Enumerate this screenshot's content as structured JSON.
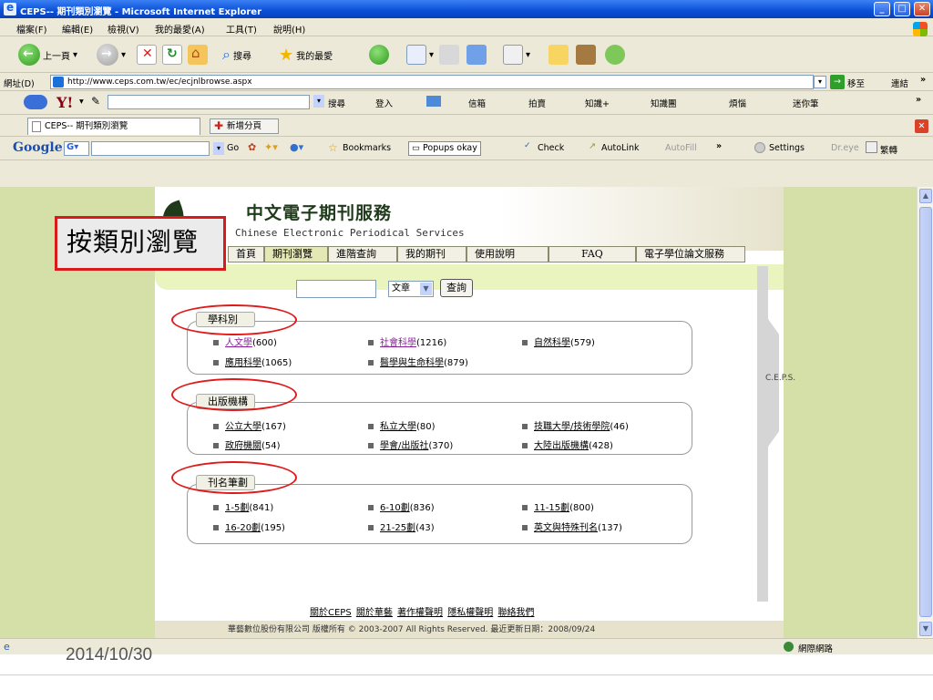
{
  "window": {
    "title": "CEPS-- 期刊類別瀏覽 - Microsoft Internet Explorer",
    "minimize": "_",
    "maximize": "□",
    "close": "✕"
  },
  "menubar": {
    "items": [
      "檔案(F)",
      "編輯(E)",
      "檢視(V)",
      "我的最愛(A)",
      "工具(T)",
      "說明(H)"
    ]
  },
  "toolbar": {
    "back_label": "上一頁",
    "search_label": "搜尋",
    "favorites_label": "我的最愛"
  },
  "address": {
    "label": "網址(D)",
    "url": "http://www.ceps.com.tw/ec/ecjnlbrowse.aspx",
    "go_label": "移至",
    "links_label": "連結"
  },
  "yahoo_toolbar": {
    "search_label": "搜尋",
    "login_label": "登入",
    "mail_label": "信箱",
    "auction_label": "拍賣",
    "knowledge_label": "知識+",
    "knowledge_group_label": "知識團",
    "worry_label": "煩惱",
    "pen_label": "迷你筆"
  },
  "tabs": {
    "current_tab": "CEPS-- 期刊類別瀏覽",
    "new_tab_label": "新增分頁"
  },
  "google_toolbar": {
    "logo": "Google",
    "g_label": "G",
    "go_label": "Go",
    "bookmarks_label": "Bookmarks",
    "popups_label": "Popups okay",
    "check_label": "Check",
    "autolink_label": "AutoLink",
    "autofill_label": "AutoFill",
    "more": "»",
    "settings_label": "Settings",
    "dreye_label": "Dr.eye",
    "convert_label": "繁轉"
  },
  "callout": {
    "text": "按類別瀏覽"
  },
  "site": {
    "title": "中文電子期刊服務",
    "subtitle": "Chinese Electronic Periodical Services",
    "side_label": "C.E.P.S.",
    "nav": [
      "首頁",
      "期刊瀏覽",
      "進階查詢",
      "我的期刊",
      "使用說明",
      "FAQ",
      "電子學位論文服務"
    ],
    "search_select": "文章",
    "search_button": "查詢"
  },
  "sections": [
    {
      "label": "學科別",
      "items": [
        {
          "name": "人文學",
          "count": "(600)"
        },
        {
          "name": "社會科學",
          "count": "(1216)"
        },
        {
          "name": "自然科學",
          "count": "(579)"
        },
        {
          "name": "應用科學",
          "count": "(1065)"
        },
        {
          "name": "醫學與生命科學",
          "count": "(879)"
        }
      ]
    },
    {
      "label": "出版機構",
      "items": [
        {
          "name": "公立大學",
          "count": "(167)"
        },
        {
          "name": "私立大學",
          "count": "(80)"
        },
        {
          "name": "技職大學/技術學院",
          "count": "(46)"
        },
        {
          "name": "政府機關",
          "count": "(54)"
        },
        {
          "name": "學會/出版社",
          "count": "(370)"
        },
        {
          "name": "大陸出版機構",
          "count": "(428)"
        }
      ]
    },
    {
      "label": "刊名筆劃",
      "items": [
        {
          "name": "1-5劃",
          "count": "(841)"
        },
        {
          "name": "6-10劃",
          "count": "(836)"
        },
        {
          "name": "11-15劃",
          "count": "(800)"
        },
        {
          "name": "16-20劃",
          "count": "(195)"
        },
        {
          "name": "21-25劃",
          "count": "(43)"
        },
        {
          "name": "英文與特殊刊名",
          "count": "(137)"
        }
      ]
    }
  ],
  "footer": {
    "links": [
      "關於CEPS",
      "關於華藝",
      "著作權聲明",
      "隱私權聲明",
      "聯絡我們"
    ],
    "copyright": "華藝數位股份有限公司 版權所有 © 2003-2007 All Rights Reserved. 最近更新日期：2008/09/24"
  },
  "statusbar": {
    "zone": "網際網路"
  },
  "slide": {
    "date": "2014/10/30"
  }
}
